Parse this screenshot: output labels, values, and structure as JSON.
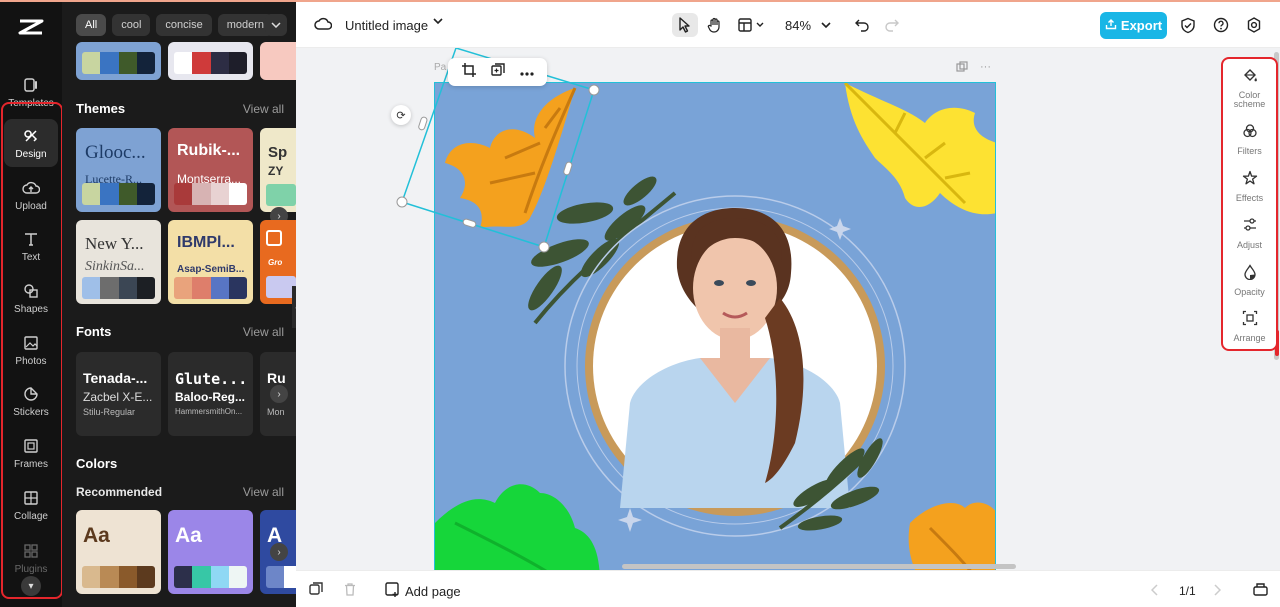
{
  "nav": {
    "items": [
      {
        "label": "Templates",
        "icon": "templates-icon"
      },
      {
        "label": "Design",
        "icon": "design-icon",
        "active": true
      },
      {
        "label": "Upload",
        "icon": "upload-icon"
      },
      {
        "label": "Text",
        "icon": "text-icon"
      },
      {
        "label": "Shapes",
        "icon": "shapes-icon"
      },
      {
        "label": "Photos",
        "icon": "photos-icon"
      },
      {
        "label": "Stickers",
        "icon": "stickers-icon"
      },
      {
        "label": "Frames",
        "icon": "frames-icon"
      },
      {
        "label": "Collage",
        "icon": "collage-icon"
      },
      {
        "label": "Plugins",
        "icon": "plugins-icon"
      }
    ]
  },
  "panel": {
    "filters": [
      "All",
      "cool",
      "concise",
      "modern"
    ],
    "themes": {
      "title": "Themes",
      "view_all": "View all",
      "cards": [
        {
          "t1": "Glooc...",
          "t2": "Lucette-R...",
          "bg": "#7ea2d3",
          "fg": "#1d3b66",
          "swatches": [
            "#c8d5a0",
            "#3a74c2",
            "#3f5a2a",
            "#13233a"
          ]
        },
        {
          "t1": "Rubik-...",
          "t2": "Montserra...",
          "bg": "#b25656",
          "fg": "#ffffff",
          "swatches": [
            "#a93a3a",
            "#d7b3b3",
            "#e8d2d2",
            "#ffffff"
          ]
        },
        {
          "t1": "New Y...",
          "t2": "SinkinSa...",
          "bg": "#e8e4dc",
          "fg": "#333333",
          "swatches": [
            "#9fbfe8",
            "#6d6d6d",
            "#3b4654",
            "#1c1f24"
          ]
        },
        {
          "t1": "IBMPl...",
          "t2": "Asap-SemiB...",
          "bg": "#f3dfa7",
          "fg": "#2f3a6b",
          "swatches": [
            "#e9a37c",
            "#de7e6b",
            "#5875c4",
            "#2a355f"
          ]
        }
      ]
    },
    "fonts": {
      "title": "Fonts",
      "view_all": "View all",
      "cards": [
        {
          "l1": "Tenada-...",
          "l2": "Zacbel X-E...",
          "l3": "Stilu-Regular"
        },
        {
          "l1": "Glute...",
          "l2": "Baloo-Reg...",
          "l3": "HammersmithOn..."
        },
        {
          "l1": "Ru",
          "l2": "",
          "l3": "Mon"
        }
      ]
    },
    "colors": {
      "title": "Colors",
      "subtitle": "Recommended",
      "view_all": "View all",
      "cards": [
        {
          "aa": "Aa",
          "bg": "#eee3d3",
          "fg": "#5c3a1e",
          "swatches": [
            "#d9b98e",
            "#b98a55",
            "#8a5a2b",
            "#5c3a1e"
          ]
        },
        {
          "aa": "Aa",
          "bg": "#9b86e8",
          "fg": "#ffffff",
          "swatches": [
            "#2c2f4a",
            "#37c7a6",
            "#8fd8f4",
            "#eef6f4"
          ]
        },
        {
          "aa": "A",
          "bg": "#2f4aa0",
          "fg": "#ffffff",
          "swatches": [
            "#6d86c8",
            "#ffffff",
            "#ffffff",
            "#ffffff"
          ]
        }
      ]
    }
  },
  "topbar": {
    "title": "Untitled image",
    "zoom": "84%",
    "export_label": "Export"
  },
  "canvas": {
    "page_label": "Pa",
    "background": "#79a3d7",
    "selection_color": "#22c0d8"
  },
  "tools": {
    "items": [
      {
        "label": "Color scheme",
        "icon": "color-scheme-icon"
      },
      {
        "label": "Filters",
        "icon": "filters-icon"
      },
      {
        "label": "Effects",
        "icon": "effects-icon"
      },
      {
        "label": "Adjust",
        "icon": "adjust-icon"
      },
      {
        "label": "Opacity",
        "icon": "opacity-icon"
      },
      {
        "label": "Arrange",
        "icon": "arrange-icon"
      }
    ]
  },
  "bottombar": {
    "add_page": "Add page",
    "pages": "1/1"
  },
  "colors": {
    "accent": "#19b6e6",
    "highlight": "#e4262c",
    "rail_bg": "#121212",
    "panel_bg": "#1b1b1b"
  }
}
